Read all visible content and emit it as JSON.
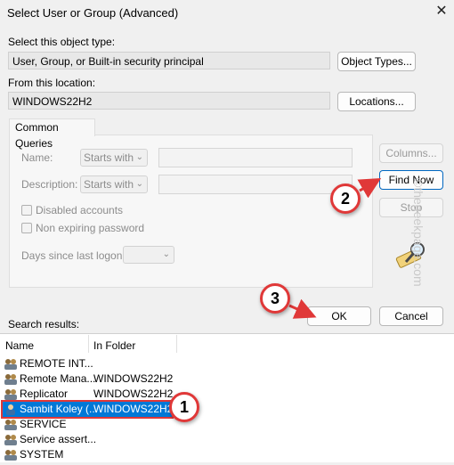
{
  "window": {
    "title": "Select User or Group (Advanced)",
    "close_glyph": "✕"
  },
  "object_type": {
    "label": "Select this object type:",
    "value": "User, Group, or Built-in security principal",
    "button": "Object Types..."
  },
  "location": {
    "label": "From this location:",
    "value": "WINDOWS22H2",
    "button": "Locations..."
  },
  "common_queries": {
    "tab": "Common Queries",
    "name_label": "Name:",
    "name_op": "Starts with",
    "description_label": "Description:",
    "description_op": "Starts with",
    "disabled_accounts": "Disabled accounts",
    "non_expiring_password": "Non expiring password",
    "days_label": "Days since last logon:"
  },
  "buttons": {
    "columns": "Columns...",
    "find_now": "Find Now",
    "stop": "Stop",
    "ok": "OK",
    "cancel": "Cancel"
  },
  "search_results": {
    "label": "Search results:",
    "columns": [
      "Name",
      "In Folder"
    ],
    "rows": [
      {
        "name": "REMOTE INT...",
        "folder": ""
      },
      {
        "name": "Remote Mana...",
        "folder": "WINDOWS22H2"
      },
      {
        "name": "Replicator",
        "folder": "WINDOWS22H2"
      },
      {
        "name": "Sambit Koley (...",
        "folder": "WINDOWS22H2",
        "selected": true
      },
      {
        "name": "SERVICE",
        "folder": ""
      },
      {
        "name": "Service assert...",
        "folder": ""
      },
      {
        "name": "SYSTEM",
        "folder": ""
      }
    ]
  },
  "callouts": [
    "1",
    "2",
    "3"
  ],
  "watermark": "©thegeekpage.com",
  "colors": {
    "callout_red": "#e03838",
    "selection_blue": "#0078d7"
  }
}
